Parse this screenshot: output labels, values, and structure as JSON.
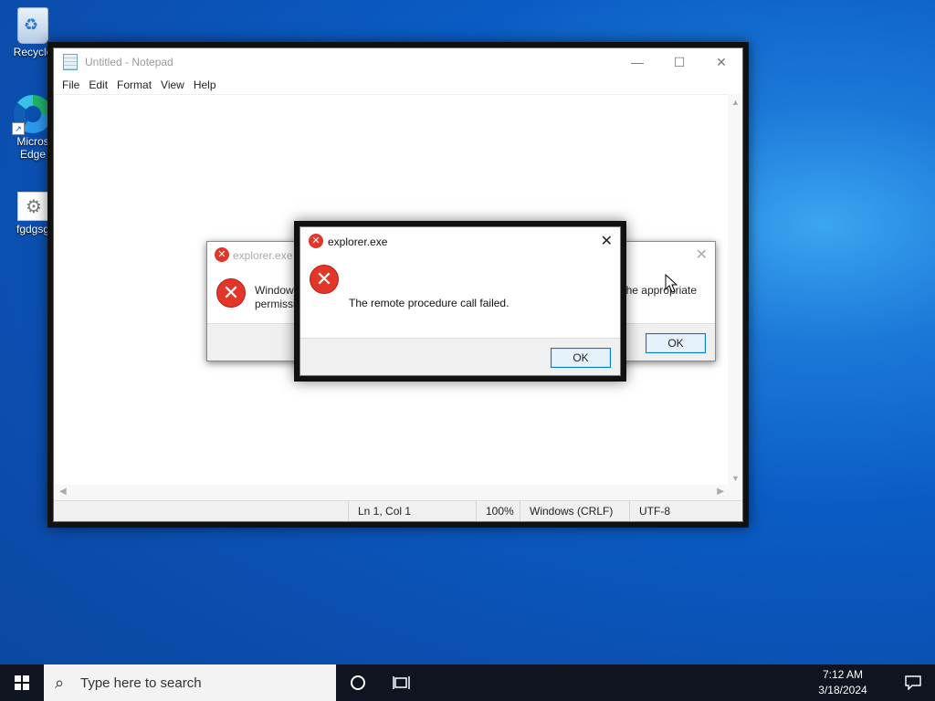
{
  "desktop": {
    "icons": [
      {
        "label": "Recycle",
        "icon": "recycle-bin-icon"
      },
      {
        "label": "Micros Edge",
        "icon": "edge-icon"
      },
      {
        "label": "fgdgsg",
        "icon": "settings-file-icon"
      }
    ]
  },
  "notepad": {
    "title": "Untitled - Notepad",
    "menu": [
      "File",
      "Edit",
      "Format",
      "View",
      "Help"
    ],
    "status": {
      "position": "Ln 1, Col 1",
      "zoom": "100%",
      "line_endings": "Windows (CRLF)",
      "encoding": "UTF-8"
    }
  },
  "dialog_back": {
    "title": "explorer.exe",
    "message_start_line1": "Windows",
    "message_start_line2": "permissio",
    "message_end": "the appropriate",
    "ok": "OK"
  },
  "dialog_front": {
    "title": "explorer.exe",
    "message": "The remote procedure call failed.",
    "ok": "OK"
  },
  "taskbar": {
    "search_placeholder": "Type here to search",
    "time": "7:12 AM",
    "date": "3/18/2024"
  },
  "colors": {
    "error": "#e2362b",
    "accent": "#0078d7",
    "taskbar": "#101421"
  }
}
